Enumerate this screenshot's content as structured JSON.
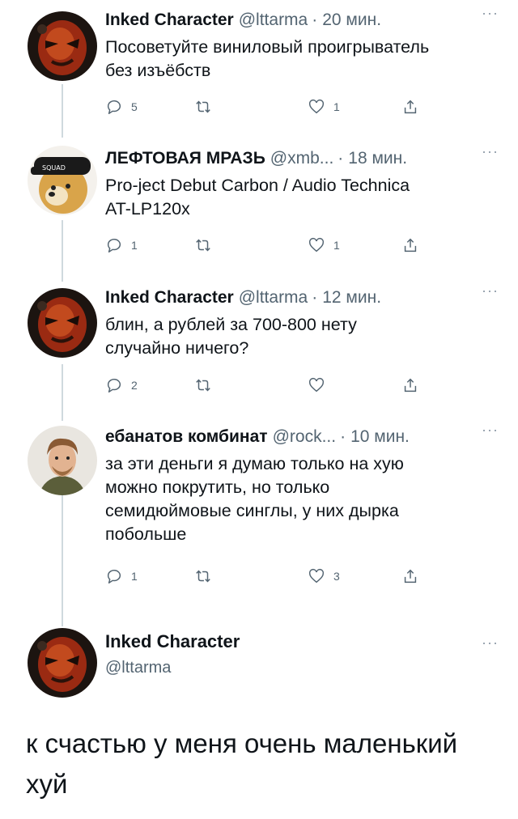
{
  "tweets": [
    {
      "name": "Inked Character",
      "handle": "@lttarma",
      "dot": "·",
      "time": "20 мин.",
      "text_lines": [
        "Посоветуйте виниловый проигрыватель",
        "без изъёбств"
      ],
      "reply_count": "5",
      "like_count": "1",
      "avatar_icon": "red-mask-avatar"
    },
    {
      "name": "ЛЕФТОВАЯ МРАЗЬ",
      "handle": "@xmb...",
      "dot": "·",
      "time": "18 мин.",
      "text_lines": [
        "Pro-ject Debut Carbon / Audio Technica",
        "AT-LP120x"
      ],
      "reply_count": "1",
      "like_count": "1",
      "avatar_icon": "doge-avatar"
    },
    {
      "name": "Inked Character",
      "handle": "@lttarma",
      "dot": "·",
      "time": "12 мин.",
      "text_lines": [
        "блин, а рублей за 700-800 нету",
        "случайно ничего?"
      ],
      "reply_count": "2",
      "like_count": "",
      "avatar_icon": "red-mask-avatar"
    },
    {
      "name": "ебанатов комбинат",
      "handle": "@rock...",
      "dot": "·",
      "time": "10 мин.",
      "text_lines": [
        "за эти деньги я думаю только на хую",
        "можно покрутить, но только",
        "семидюймовые синглы, у них дырка",
        "побольше"
      ],
      "reply_count": "1",
      "like_count": "3",
      "avatar_icon": "person-photo-avatar"
    }
  ],
  "final_tweet": {
    "name": "Inked Character",
    "handle": "@lttarma",
    "text_lines": [
      "к счастью у меня очень маленький",
      "хуй"
    ]
  },
  "more_label": "···",
  "colors": {
    "text": "#0f1419",
    "secondary": "#536471",
    "line": "#cfd9de"
  }
}
